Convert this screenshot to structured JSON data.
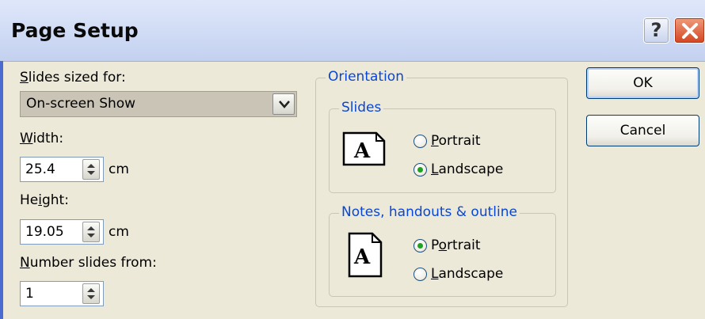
{
  "window": {
    "title": "Page Setup",
    "help_label": "?"
  },
  "left": {
    "slides_sized_for": {
      "label_accel": "S",
      "label_rest": "lides sized for:",
      "value": "On-screen Show"
    },
    "width": {
      "label_accel": "W",
      "label_rest": "idth:",
      "value": "25.4",
      "unit": "cm"
    },
    "height": {
      "label_pre": "He",
      "label_accel": "i",
      "label_rest": "ght:",
      "value": "19.05",
      "unit": "cm"
    },
    "number_from": {
      "label_accel": "N",
      "label_rest": "umber slides from:",
      "value": "1"
    }
  },
  "orientation": {
    "title": "Orientation",
    "slides": {
      "title": "Slides",
      "portrait": {
        "accel": "P",
        "rest": "ortrait",
        "checked": false
      },
      "landscape": {
        "accel": "L",
        "rest": "andscape",
        "checked": true
      }
    },
    "notes": {
      "title": "Notes, handouts & outline",
      "portrait": {
        "pre": "P",
        "accel": "o",
        "rest": "rtrait",
        "checked": true
      },
      "landscape": {
        "accel": "L",
        "rest": "andscape",
        "checked": false
      }
    }
  },
  "buttons": {
    "ok": "OK",
    "cancel": "Cancel"
  },
  "icons": {
    "page_icon_glyph": "A"
  }
}
